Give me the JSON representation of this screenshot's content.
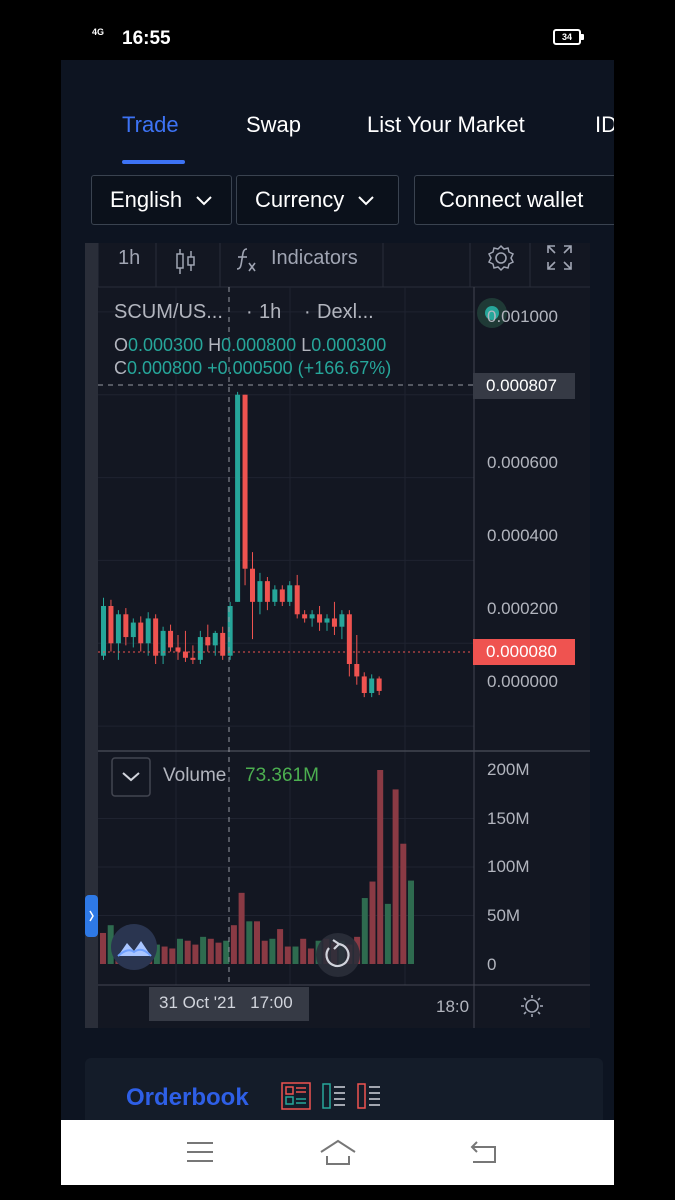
{
  "status_bar": {
    "network": "4G",
    "time": "16:55",
    "battery": "34"
  },
  "nav": {
    "tabs": [
      {
        "label": "Trade",
        "active": true
      },
      {
        "label": "Swap",
        "active": false
      },
      {
        "label": "List Your Market",
        "active": false
      },
      {
        "label": "ID",
        "active": false
      }
    ]
  },
  "controls": {
    "language": "English",
    "currency": "Currency",
    "connect_wallet": "Connect wallet"
  },
  "chart_toolbar": {
    "interval": "1h",
    "indicators": "Indicators"
  },
  "chart_legend": {
    "symbol": "SCUM/US...",
    "interval": "1h",
    "exchange": "Dexl...",
    "open_label": "O",
    "open": "0.000300",
    "high_label": "H",
    "high": "0.000800",
    "low_label": "L",
    "low": "0.000300",
    "close_label": "C",
    "close": "0.000800",
    "change": "+0.000500 (+166.67%)"
  },
  "price_axis": {
    "labels": [
      "0.001000",
      "0.000600",
      "0.000400",
      "0.000200",
      "0.000000"
    ],
    "crosshair_price": "0.000807",
    "last_price": "0.000080"
  },
  "volume_pane": {
    "label": "Volume",
    "value": "73.361M",
    "axis_labels": [
      "200M",
      "150M",
      "100M",
      "50M",
      "0"
    ]
  },
  "time_axis": {
    "crosshair_time": "31 Oct '21   17:00",
    "tick": "18:0"
  },
  "orderbook": {
    "title": "Orderbook"
  },
  "colors": {
    "up": "#26a69a",
    "down": "#ef5350",
    "accent": "#3d73f5",
    "background": "#131722"
  },
  "chart_data": {
    "type": "candlestick",
    "symbol": "SCUM/US...",
    "interval": "1h",
    "price_range": [
      -6e-05,
      0.00106
    ],
    "volume_range": [
      0,
      200000000
    ],
    "candles": [
      {
        "o": 0.00017,
        "h": 0.00031,
        "l": 0.00016,
        "c": 0.00029
      },
      {
        "o": 0.00029,
        "h": 0.000305,
        "l": 0.00018,
        "c": 0.0002
      },
      {
        "o": 0.0002,
        "h": 0.00028,
        "l": 0.00016,
        "c": 0.00027
      },
      {
        "o": 0.00027,
        "h": 0.000285,
        "l": 0.000195,
        "c": 0.000215
      },
      {
        "o": 0.000215,
        "h": 0.00026,
        "l": 0.00019,
        "c": 0.00025
      },
      {
        "o": 0.00025,
        "h": 0.000265,
        "l": 0.00018,
        "c": 0.0002
      },
      {
        "o": 0.0002,
        "h": 0.000275,
        "l": 0.00017,
        "c": 0.00026
      },
      {
        "o": 0.00026,
        "h": 0.00027,
        "l": 0.00015,
        "c": 0.00017
      },
      {
        "o": 0.00017,
        "h": 0.00024,
        "l": 0.00015,
        "c": 0.00023
      },
      {
        "o": 0.00023,
        "h": 0.000245,
        "l": 0.00018,
        "c": 0.00019
      },
      {
        "o": 0.00019,
        "h": 0.00022,
        "l": 0.00016,
        "c": 0.00018
      },
      {
        "o": 0.00018,
        "h": 0.00023,
        "l": 0.000155,
        "c": 0.000165
      },
      {
        "o": 0.000165,
        "h": 0.000195,
        "l": 0.00015,
        "c": 0.00016
      },
      {
        "o": 0.00016,
        "h": 0.00023,
        "l": 0.00015,
        "c": 0.000215
      },
      {
        "o": 0.000215,
        "h": 0.000245,
        "l": 0.00018,
        "c": 0.000195
      },
      {
        "o": 0.000195,
        "h": 0.00023,
        "l": 0.00017,
        "c": 0.000225
      },
      {
        "o": 0.000225,
        "h": 0.00024,
        "l": 0.00016,
        "c": 0.00017
      },
      {
        "o": 0.00017,
        "h": 0.0003,
        "l": 0.00016,
        "c": 0.00029
      },
      {
        "o": 0.0003,
        "h": 0.000807,
        "l": 0.0003,
        "c": 0.0008
      },
      {
        "o": 0.0008,
        "h": 0.0008,
        "l": 0.00034,
        "c": 0.00038
      },
      {
        "o": 0.00038,
        "h": 0.00042,
        "l": 0.00021,
        "c": 0.0003
      },
      {
        "o": 0.0003,
        "h": 0.00037,
        "l": 0.00027,
        "c": 0.00035
      },
      {
        "o": 0.00035,
        "h": 0.00036,
        "l": 0.00028,
        "c": 0.0003
      },
      {
        "o": 0.0003,
        "h": 0.00034,
        "l": 0.00029,
        "c": 0.00033
      },
      {
        "o": 0.00033,
        "h": 0.00034,
        "l": 0.00029,
        "c": 0.0003
      },
      {
        "o": 0.0003,
        "h": 0.00035,
        "l": 0.00029,
        "c": 0.00034
      },
      {
        "o": 0.00034,
        "h": 0.000365,
        "l": 0.00026,
        "c": 0.00027
      },
      {
        "o": 0.00027,
        "h": 0.00028,
        "l": 0.00025,
        "c": 0.00026
      },
      {
        "o": 0.00026,
        "h": 0.00028,
        "l": 0.00024,
        "c": 0.00027
      },
      {
        "o": 0.00027,
        "h": 0.00029,
        "l": 0.00023,
        "c": 0.00025
      },
      {
        "o": 0.00025,
        "h": 0.00027,
        "l": 0.00023,
        "c": 0.00026
      },
      {
        "o": 0.00026,
        "h": 0.0003,
        "l": 0.00022,
        "c": 0.00024
      },
      {
        "o": 0.00024,
        "h": 0.00028,
        "l": 0.00021,
        "c": 0.00027
      },
      {
        "o": 0.00027,
        "h": 0.00028,
        "l": 0.00012,
        "c": 0.00015
      },
      {
        "o": 0.00015,
        "h": 0.00022,
        "l": 0.0001,
        "c": 0.00012
      },
      {
        "o": 0.00012,
        "h": 0.00013,
        "l": 7e-05,
        "c": 8e-05
      },
      {
        "o": 8e-05,
        "h": 0.000125,
        "l": 7e-05,
        "c": 0.000115
      },
      {
        "o": 0.000115,
        "h": 0.00012,
        "l": 7.5e-05,
        "c": 8.5e-05
      }
    ],
    "volumes": [
      32000000,
      40000000,
      26000000,
      22000000,
      28000000,
      24000000,
      30000000,
      20000000,
      18000000,
      16000000,
      26000000,
      24000000,
      20000000,
      28000000,
      26000000,
      22000000,
      24000000,
      40000000,
      73361000,
      44000000,
      44000000,
      24000000,
      26000000,
      36000000,
      18000000,
      18000000,
      26000000,
      16000000,
      24000000,
      26000000,
      22000000,
      24000000,
      20000000,
      28000000,
      68000000,
      85000000,
      200000000,
      62000000,
      180000000,
      124000000,
      86000000
    ]
  }
}
